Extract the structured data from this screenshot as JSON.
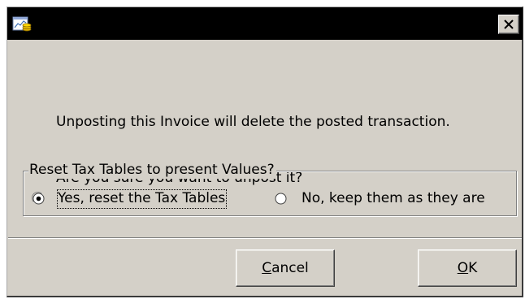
{
  "dialog": {
    "title": "",
    "message_lines": [
      "Unposting this Invoice will delete the posted transaction.",
      "Are you sure you want to unpost it?"
    ],
    "close_icon": "close-icon"
  },
  "tax_reset": {
    "group_label": "Reset Tax Tables to present Values?",
    "options": [
      {
        "label": "Yes, reset the Tax Tables",
        "selected": true
      },
      {
        "label": "No, keep them as they are",
        "selected": false
      }
    ]
  },
  "buttons": {
    "cancel": {
      "mnemonic": "C",
      "rest": "ancel"
    },
    "ok": {
      "mnemonic": "O",
      "rest": "K"
    }
  }
}
